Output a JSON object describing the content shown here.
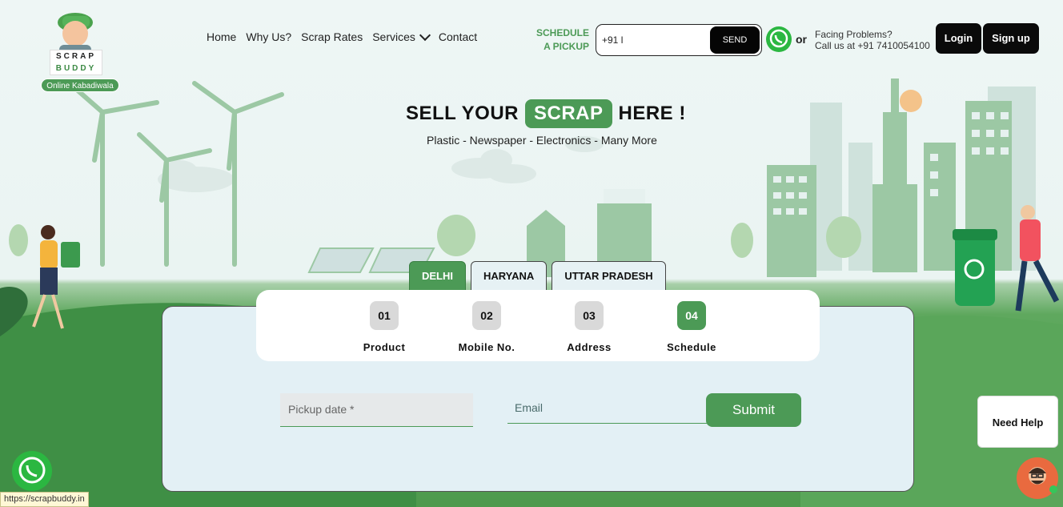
{
  "brand": {
    "logo_top": "SCRAP",
    "logo_bottom": "BUDDY",
    "tagline": "Online Kabadiwala"
  },
  "nav": {
    "items": [
      "Home",
      "Why Us?",
      "Scrap Rates",
      "Services",
      "Contact"
    ]
  },
  "header": {
    "schedule_line1": "SCHEDULE",
    "schedule_line2": "A PICKUP",
    "phone_value": "+91 l",
    "send_label": "SEND",
    "or_label": "or",
    "facing_line1": "Facing Problems?",
    "facing_line2": "Call us at +91 7410054100",
    "login_label": "Login",
    "signup_label": "Sign up"
  },
  "hero": {
    "title_pre": "SELL YOUR",
    "title_highlight": "SCRAP",
    "title_post": "HERE !",
    "subtitle": "Plastic - Newspaper - Electronics - Many More"
  },
  "tabs": {
    "items": [
      "DELHI",
      "HARYANA",
      "UTTAR PRADESH"
    ],
    "active": "DELHI"
  },
  "steps": {
    "items": [
      {
        "num": "01",
        "label": "Product"
      },
      {
        "num": "02",
        "label": "Mobile No."
      },
      {
        "num": "03",
        "label": "Address"
      },
      {
        "num": "04",
        "label": "Schedule"
      }
    ],
    "active": "04"
  },
  "form": {
    "pickup_placeholder": "Pickup date *",
    "email_placeholder": "Email",
    "submit_label": "Submit"
  },
  "widgets": {
    "need_help": "Need Help",
    "status_url": "https://scrapbuddy.in"
  },
  "colors": {
    "brand_green": "#4c9a56",
    "dark": "#0a0a0a"
  },
  "icons": [
    "whatsapp-icon",
    "chevron-down-icon",
    "support-avatar-icon"
  ]
}
